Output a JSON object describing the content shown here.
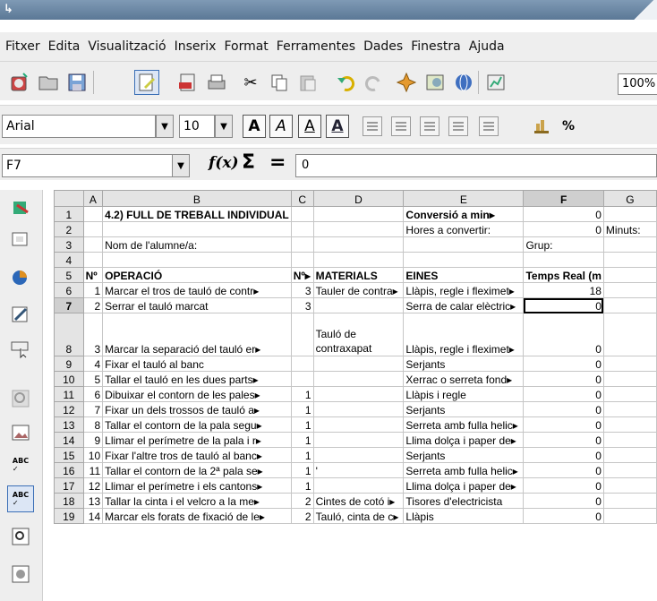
{
  "menu": [
    "Fitxer",
    "Edita",
    "Visualització",
    "Inserix",
    "Format",
    "Ferramentes",
    "Dades",
    "Finestra",
    "Ajuda"
  ],
  "toolbar": {
    "icons": [
      "new-document-icon",
      "open-folder-icon",
      "save-icon",
      "edit-mode-icon",
      "export-pdf-icon",
      "print-icon",
      "cut-icon",
      "copy-icon",
      "paste-icon",
      "undo-icon",
      "redo-icon",
      "navigator-icon",
      "gallery-icon",
      "data-sources-icon",
      "chart-icon"
    ],
    "zoom": "100%"
  },
  "format_bar": {
    "font_name": "Arial",
    "font_size": "10",
    "bold_label": "A",
    "italic_label": "A",
    "underline_label": "A",
    "font_color_label": "A",
    "percent_label": "%"
  },
  "formula_bar": {
    "cell_ref": "F7",
    "fx_label": "f(x)",
    "sum_label": "Σ",
    "equals_label": "=",
    "value": "0"
  },
  "columns": [
    "",
    "A",
    "B",
    "C",
    "D",
    "E",
    "F",
    "G"
  ],
  "active_column": "F",
  "active_row": "7",
  "rows": [
    {
      "n": "1",
      "a": "",
      "b": "4.2) FULL DE TREBALL INDIVIDUAL",
      "c": "",
      "d": "",
      "e": "Conversió a min▸",
      "f": "0",
      "g": ""
    },
    {
      "n": "2",
      "a": "",
      "b": "",
      "c": "",
      "d": "",
      "e": "Hores a convertir:",
      "f": "0",
      "g": "Minuts:"
    },
    {
      "n": "3",
      "a": "",
      "b": "Nom de l'alumne/a:",
      "c": "",
      "d": "",
      "e": "",
      "f": "Grup:",
      "g": ""
    },
    {
      "n": "4",
      "a": "",
      "b": "",
      "c": "",
      "d": "",
      "e": "",
      "f": "",
      "g": ""
    },
    {
      "n": "5",
      "a": "Nº",
      "b": "OPERACIÓ",
      "c": "Nº▸",
      "d": "MATERIALS",
      "e": "EINES",
      "f": "Temps Real (m",
      "g": ""
    },
    {
      "n": "6",
      "a": "1",
      "b": "Marcar el tros de tauló de contr▸",
      "c": "3",
      "d": "Tauler de contra▸",
      "e": "Llàpis, regle i fleximet▸",
      "f": "18",
      "g": ""
    },
    {
      "n": "7",
      "a": "2",
      "b": "Serrar el tauló marcat",
      "c": "3",
      "d": "",
      "e": "Serra de calar elèctric▸",
      "f": "0",
      "g": ""
    },
    {
      "n": "8",
      "a": "3",
      "b": "Marcar la separació del tauló er▸",
      "c": "",
      "d": "Tauló de contraxapat",
      "e": "Llàpis, regle i fleximet▸",
      "f": "0",
      "g": ""
    },
    {
      "n": "9",
      "a": "4",
      "b": "Fixar el tauló al banc",
      "c": "",
      "d": "",
      "e": "Serjants",
      "f": "0",
      "g": ""
    },
    {
      "n": "10",
      "a": "5",
      "b": "Tallar el tauló en les dues parts▸",
      "c": "",
      "d": "",
      "e": "Xerrac o serreta fond▸",
      "f": "0",
      "g": ""
    },
    {
      "n": "11",
      "a": "6",
      "b": "Dibuixar el contorn de les pales▸",
      "c": "1",
      "d": "",
      "e": "Llàpis i regle",
      "f": "0",
      "g": ""
    },
    {
      "n": "12",
      "a": "7",
      "b": "Fixar un dels trossos de tauló a▸",
      "c": "1",
      "d": "",
      "e": "Serjants",
      "f": "0",
      "g": ""
    },
    {
      "n": "13",
      "a": "8",
      "b": "Tallar el contorn de la pala segu▸",
      "c": "1",
      "d": "",
      "e": "Serreta amb fulla helic▸",
      "f": "0",
      "g": ""
    },
    {
      "n": "14",
      "a": "9",
      "b": "Llimar el perímetre de la pala i r▸",
      "c": "1",
      "d": "",
      "e": "Llima dolça i paper de▸",
      "f": "0",
      "g": ""
    },
    {
      "n": "15",
      "a": "10",
      "b": "Fixar l'altre tros de tauló al banc▸",
      "c": "1",
      "d": "",
      "e": "Serjants",
      "f": "0",
      "g": ""
    },
    {
      "n": "16",
      "a": "11",
      "b": "Tallar el contorn de la 2ª pala se▸",
      "c": "1",
      "d": "'",
      "e": "Serreta amb fulla helic▸",
      "f": "0",
      "g": ""
    },
    {
      "n": "17",
      "a": "12",
      "b": "Llimar el perímetre i els cantons▸",
      "c": "1",
      "d": "",
      "e": "Llima dolça i paper de▸",
      "f": "0",
      "g": ""
    },
    {
      "n": "18",
      "a": "13",
      "b": "Tallar la cinta i el velcro a la me▸",
      "c": "2",
      "d": "Cintes de cotó i▸",
      "e": "Tisores d'electricista",
      "f": "0",
      "g": ""
    },
    {
      "n": "19",
      "a": "14",
      "b": "Marcar els forats de fixació de le▸",
      "c": "2",
      "d": "Tauló, cinta de c▸",
      "e": "Llàpis",
      "f": "0",
      "g": ""
    }
  ]
}
